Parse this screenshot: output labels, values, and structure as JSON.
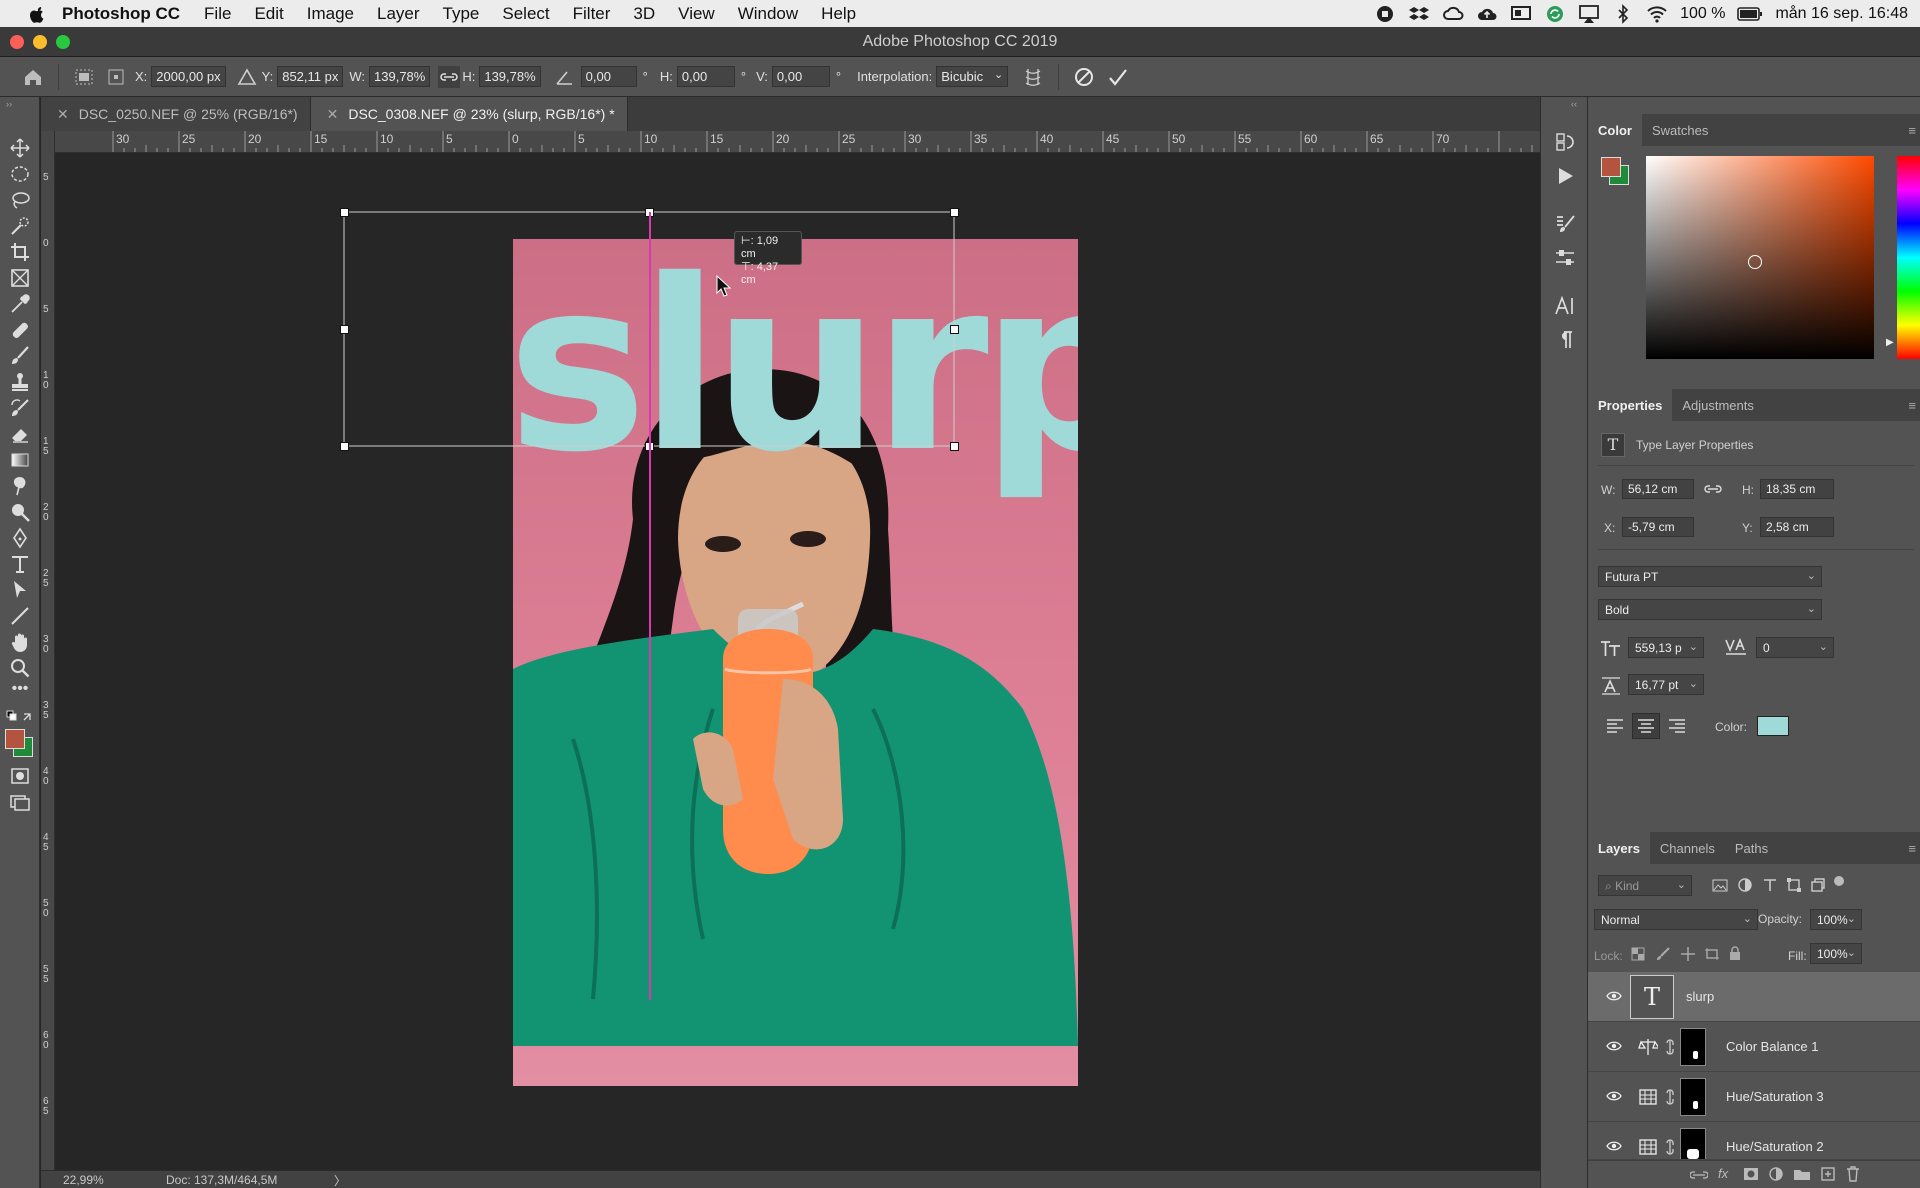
{
  "menubar": {
    "app_name": "Photoshop CC",
    "items": [
      "File",
      "Edit",
      "Image",
      "Layer",
      "Type",
      "Select",
      "Filter",
      "3D",
      "View",
      "Window",
      "Help"
    ],
    "battery": "100 %",
    "datetime": "mån 16 sep. 16:48"
  },
  "window": {
    "title": "Adobe Photoshop CC 2019"
  },
  "options": {
    "x_label": "X:",
    "x_value": "2000,00 px",
    "y_label": "Y:",
    "y_value": "852,11 px",
    "w_label": "W:",
    "w_value": "139,78%",
    "h_label": "H:",
    "h_value": "139,78%",
    "angle_value": "0,00",
    "deg": "°",
    "hskew_label": "H:",
    "hskew_value": "0,00",
    "vskew_label": "V:",
    "vskew_value": "0,00",
    "interp_label": "Interpolation:",
    "interp_value": "Bicubic"
  },
  "tabs": [
    {
      "label": "DSC_0250.NEF @ 25% (RGB/16*)",
      "active": false
    },
    {
      "label": "DSC_0308.NEF @ 23% (slurp, RGB/16*) *",
      "active": true
    }
  ],
  "rulers": {
    "h_ticks": [
      "30",
      "25",
      "20",
      "15",
      "10",
      "5",
      "0",
      "5",
      "10",
      "15",
      "20",
      "25",
      "30",
      "35",
      "40",
      "45",
      "50",
      "55",
      "60",
      "65",
      "70"
    ],
    "v_ticks": [
      "5",
      "0",
      "5",
      "1\n0",
      "1\n5",
      "2\n0",
      "2\n5",
      "3\n0",
      "3\n5",
      "4\n0",
      "4\n5",
      "5\n0",
      "5\n5",
      "6\n0",
      "6\n5"
    ]
  },
  "canvas": {
    "text_layer": "slurp",
    "tooltip_line1": "⊢: 1,09 cm",
    "tooltip_line2": "⊤: 4,37 cm"
  },
  "status": {
    "zoom": "22,99%",
    "doc": "Doc: 137,3M/464,5M",
    "arrow": "〉"
  },
  "color_panel": {
    "tabs": [
      "Color",
      "Swatches"
    ],
    "fg_color": "#b4543e",
    "bg_color": "#1f8a3a"
  },
  "properties_panel": {
    "tabs": [
      "Properties",
      "Adjustments"
    ],
    "heading": "Type Layer Properties",
    "w_label": "W:",
    "w_value": "56,12 cm",
    "h_label": "H:",
    "h_value": "18,35 cm",
    "x_label": "X:",
    "x_value": "-5,79 cm",
    "y_label": "Y:",
    "y_value": "2,58 cm",
    "font": "Futura PT",
    "style": "Bold",
    "size": "559,13 p",
    "tracking": "0",
    "leading": "16,77 pt",
    "color_label": "Color:",
    "text_color": "#9fdad8"
  },
  "layers_panel": {
    "tabs": [
      "Layers",
      "Channels",
      "Paths"
    ],
    "kind_placeholder": "Kind",
    "blend_mode": "Normal",
    "opacity_label": "Opacity:",
    "opacity": "100%",
    "lock_label": "Lock:",
    "fill_label": "Fill:",
    "fill": "100%",
    "layers": [
      {
        "name": "slurp",
        "type": "text",
        "selected": true
      },
      {
        "name": "Color Balance 1",
        "type": "adjustment"
      },
      {
        "name": "Hue/Saturation 3",
        "type": "adjustment"
      },
      {
        "name": "Hue/Saturation 2",
        "type": "adjustment"
      }
    ]
  }
}
